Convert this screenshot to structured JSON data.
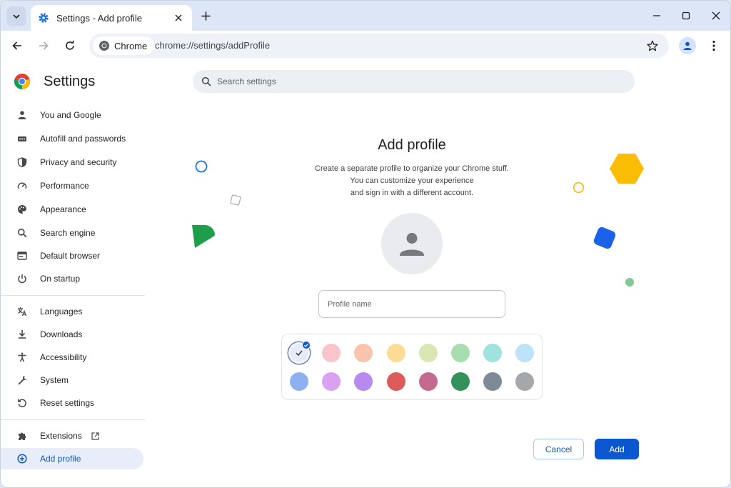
{
  "window": {
    "tab_title": "Settings - Add profile",
    "controls": [
      "minimize-icon",
      "maximize-icon",
      "close-icon"
    ]
  },
  "toolbar": {
    "chip_label": "Chrome",
    "url": "chrome://settings/addProfile"
  },
  "sidebar": {
    "title": "Settings",
    "items": [
      {
        "label": "You and Google",
        "icon": "person-icon"
      },
      {
        "label": "Autofill and passwords",
        "icon": "autofill-icon"
      },
      {
        "label": "Privacy and security",
        "icon": "shield-icon"
      },
      {
        "label": "Performance",
        "icon": "speedometer-icon"
      },
      {
        "label": "Appearance",
        "icon": "palette-icon"
      },
      {
        "label": "Search engine",
        "icon": "search-icon"
      },
      {
        "label": "Default browser",
        "icon": "browser-icon"
      },
      {
        "label": "On startup",
        "icon": "power-icon"
      },
      {
        "label": "Languages",
        "icon": "translate-icon"
      },
      {
        "label": "Downloads",
        "icon": "download-icon"
      },
      {
        "label": "Accessibility",
        "icon": "accessibility-icon"
      },
      {
        "label": "System",
        "icon": "wrench-icon"
      },
      {
        "label": "Reset settings",
        "icon": "reset-icon"
      },
      {
        "label": "Extensions",
        "icon": "puzzle-icon"
      },
      {
        "label": "Add profile",
        "icon": "add-circle-icon"
      }
    ]
  },
  "search": {
    "placeholder": "Search settings"
  },
  "main": {
    "title": "Add profile",
    "description": [
      "Create a separate profile to organize your Chrome stuff.",
      "You can customize your experience",
      "and sign in with a different account."
    ],
    "name_placeholder": "Profile name",
    "name_value": "",
    "colors": [
      "#e6ecf7",
      "#f8c5cd",
      "#f9c3ac",
      "#fcdc94",
      "#d9e8b2",
      "#a8ddb0",
      "#9ee3dd",
      "#bde3fa",
      "#8fb0f0",
      "#d9a1ef",
      "#b78af0",
      "#de5b5b",
      "#c46a8e",
      "#34915c",
      "#7d8a97",
      "#a5a8ab"
    ],
    "selected_color_index": 0,
    "cancel_label": "Cancel",
    "add_label": "Add"
  },
  "accent_color": "#0b57d0"
}
